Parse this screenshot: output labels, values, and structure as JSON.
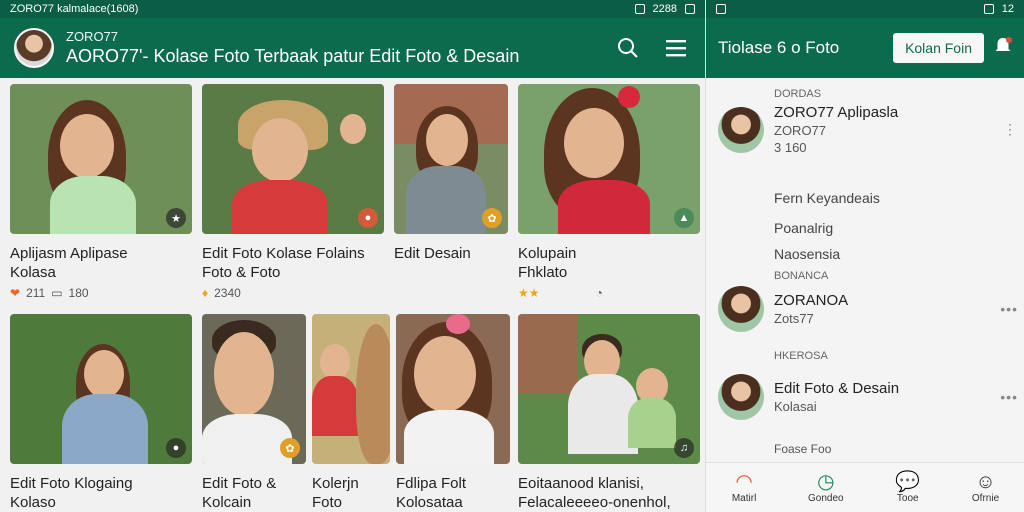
{
  "left": {
    "status": {
      "left_text": "ZORO77 kalmalace(1608)",
      "right_text": "2288"
    },
    "appbar": {
      "handle": "ZORO77",
      "title": "AORO77'- Kolase Foto Terbaak patur Edit Foto & Desain",
      "icons": [
        "search-icon",
        "menu-icon"
      ]
    },
    "cards": [
      {
        "title_line1": "Aplijasm Aplipase",
        "title_line2": "Kolasa",
        "meta": "211",
        "meta2": "180",
        "badge": "★",
        "bg": "#6f8f58",
        "body": "#b8e3b3"
      },
      {
        "title_line1": "Edit Foto Kolase Folains",
        "title_line2": "Foto & Foto",
        "meta": "2340",
        "meta2": "",
        "badge": "●",
        "bg": "#5a7a46",
        "body": "#d63b3b"
      },
      {
        "title_line1": "Edit Desain",
        "title_line2": "",
        "meta": "",
        "meta2": "",
        "badge": "✿",
        "bg": "#7a8c63",
        "body": "#7d8b93"
      },
      {
        "title_line1": "Kolupain",
        "title_line2": "Fhklato",
        "meta": "",
        "meta2": "",
        "badge": "▲",
        "bg": "#7aa06b",
        "body": "#d1283c"
      },
      {
        "title_line1": "Edit Foto Klogaing",
        "title_line2": "Kolaso",
        "meta": "",
        "meta2": "",
        "badge": "●",
        "bg": "#4e7a3b",
        "body": "#8aa9c9"
      },
      {
        "title_line1": "Edit Foto &",
        "title_line2": "Kolcain",
        "meta": "",
        "meta2": "",
        "badge": "✿",
        "bg": "#6b6a58",
        "body": "#f0f0f0"
      },
      {
        "title_line1": "Kolerjn",
        "title_line2": "Foto",
        "meta": "",
        "meta2": "",
        "badge": "",
        "bg": "#c6b07a",
        "body": "#d9b9a1"
      },
      {
        "title_line1": "Fdlipa Folt",
        "title_line2": "Kolosataa",
        "meta": "",
        "meta2": "",
        "badge": "",
        "bg": "#8a6a54",
        "body": "#f2f2f2"
      },
      {
        "title_line1": "Eoitaanood klanisi,",
        "title_line2": "Felacaleeeeo-onenhol,",
        "meta": "",
        "meta2": "",
        "badge": "♫",
        "bg": "#5c8a48",
        "body": "#e9e9e9"
      }
    ]
  },
  "right": {
    "status": {
      "right_text": "12"
    },
    "appbar": {
      "title": "Tiolase 6 o Foto",
      "button": "Kolan Foin"
    },
    "sections": {
      "s1": "DORDAS",
      "s2": "BONANCA",
      "s3": "HKEROSA",
      "s4": "Foase Foo"
    },
    "items": {
      "a": {
        "name": "ZORO77  Aplipasla",
        "sub": "ZORO77",
        "sub2": "3 160"
      },
      "b": {
        "name": "ZORANOA",
        "sub": "Zots77"
      },
      "c": {
        "name": "Edit Foto & Desain",
        "sub": "Kolasai"
      }
    },
    "lines": [
      "Fern Keyandeais",
      "Poanalrig",
      "Naosensia"
    ],
    "nav": [
      {
        "label": "Matirl",
        "icon": "gauge-icon"
      },
      {
        "label": "Gondeo",
        "icon": "clock-icon"
      },
      {
        "label": "Tooe",
        "icon": "chat-icon"
      },
      {
        "label": "Ofrnie",
        "icon": "smile-icon"
      }
    ]
  }
}
